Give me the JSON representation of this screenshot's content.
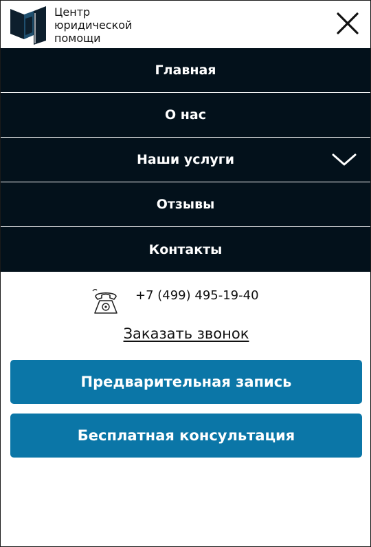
{
  "header": {
    "logo_line1": "Центр",
    "logo_line2": "юридической",
    "logo_line3": "помощи",
    "logo_icon": "book-icon",
    "close_icon": "close-icon"
  },
  "nav": {
    "items": [
      {
        "label": "Главная"
      },
      {
        "label": "О нас"
      },
      {
        "label": "Наши услуги",
        "icon": "chevron-down-icon"
      },
      {
        "label": "Отзывы"
      },
      {
        "label": "Контакты"
      }
    ]
  },
  "contact": {
    "phone_icon": "telephone-icon",
    "phone": "+7 (499) 495-19-40",
    "callback_label": "Заказать звонок"
  },
  "buttons": {
    "appointment_label": "Предварительная запись",
    "consultation_label": "Бесплатная консультация"
  },
  "colors": {
    "nav_bg": "#03111b",
    "cta_bg": "#0b76a7",
    "logo_blue": "#1f4f6e"
  }
}
